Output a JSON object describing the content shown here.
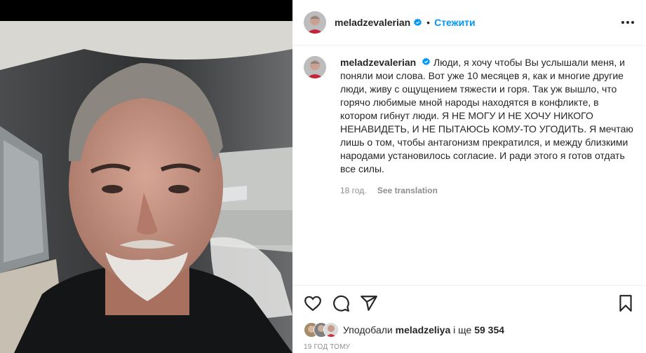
{
  "post": {
    "username": "meladzevalerian",
    "dot": "•",
    "follow_label": "Стежити",
    "caption": "Люди, я хочу чтобы Вы услышали меня, и поняли мои слова. Вот уже 10 месяцев я, как и многие другие люди, живу с ощущением тяжести и горя. Так уж вышло, что горячо любимые мной народы находятся в конфликте, в котором гибнут люди. Я НЕ МОГУ И НЕ ХОЧУ НИКОГО НЕНАВИДЕТЬ, И НЕ ПЫТАЮСЬ КОМУ-ТО УГОДИТЬ. Я мечтаю лишь о том, чтобы антагонизм прекратился, и между близкими народами установилось согласие. И ради этого я готов отдать все силы.",
    "caption_age": "18 год.",
    "see_translation": "See translation",
    "liked_prefix": "Уподобали",
    "liked_user": "meladzeliya",
    "liked_mid": "і ще",
    "liked_count": "59 354",
    "timestamp": "19 ГОД ТОМУ"
  },
  "icons": {
    "verified": "verified-badge",
    "more": "more-horizontal",
    "like": "heart-outline",
    "comment": "speech-bubble",
    "share": "paper-plane",
    "save": "bookmark-outline"
  },
  "colors": {
    "accent": "#0095f6",
    "verified": "#0095f6",
    "text": "#262626",
    "muted": "#8e8e8e"
  }
}
